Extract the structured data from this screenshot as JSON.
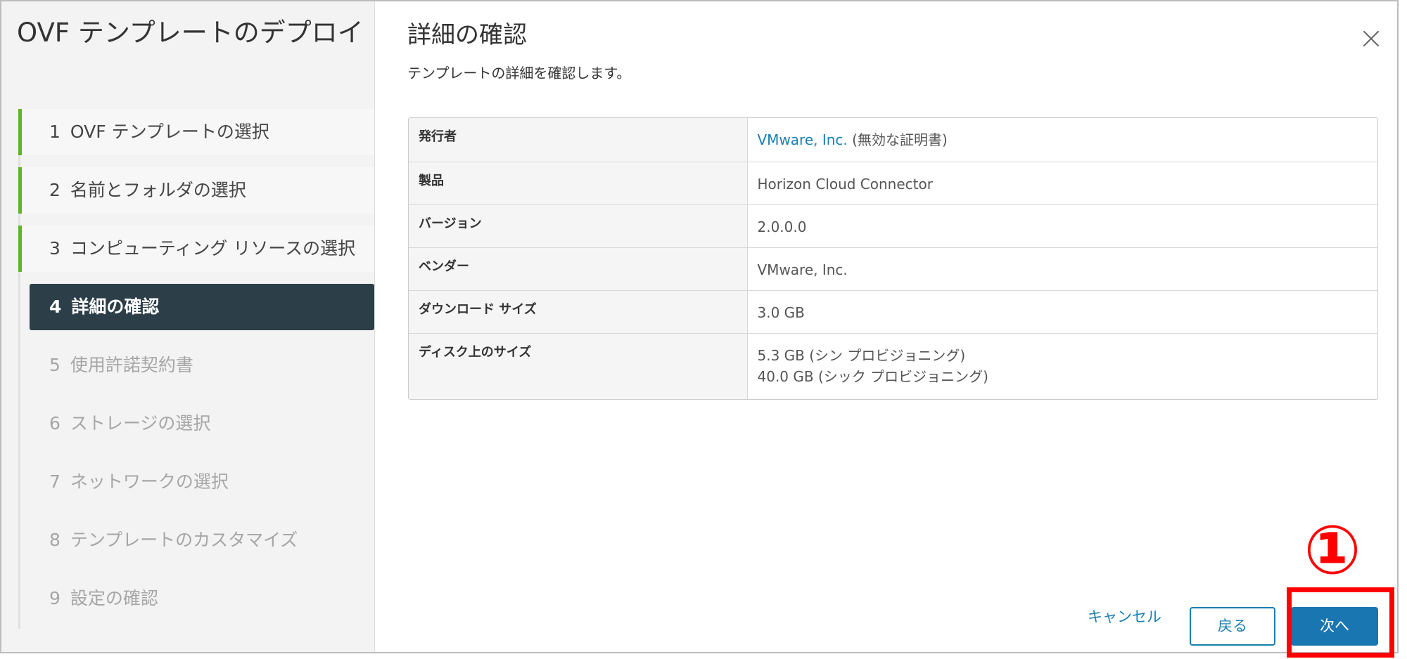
{
  "sidebar": {
    "title": "OVF テンプレートのデプロイ",
    "steps": [
      {
        "num": "1",
        "label": "OVF テンプレートの選択",
        "state": "done"
      },
      {
        "num": "2",
        "label": "名前とフォルダの選択",
        "state": "done"
      },
      {
        "num": "3",
        "label": "コンピューティング リソースの選択",
        "state": "done"
      },
      {
        "num": "4",
        "label": "詳細の確認",
        "state": "active"
      },
      {
        "num": "5",
        "label": "使用許諾契約書",
        "state": "pending"
      },
      {
        "num": "6",
        "label": "ストレージの選択",
        "state": "pending"
      },
      {
        "num": "7",
        "label": "ネットワークの選択",
        "state": "pending"
      },
      {
        "num": "8",
        "label": "テンプレートのカスタマイズ",
        "state": "pending"
      },
      {
        "num": "9",
        "label": "設定の確認",
        "state": "pending"
      }
    ]
  },
  "main": {
    "title": "詳細の確認",
    "subtitle": "テンプレートの詳細を確認します。",
    "close_icon": "close-icon",
    "details": [
      {
        "key": "発行者",
        "value_link": "VMware, Inc.",
        "value_suffix": " (無効な証明書)"
      },
      {
        "key": "製品",
        "value": "Horizon Cloud Connector"
      },
      {
        "key": "バージョン",
        "value": "2.0.0.0"
      },
      {
        "key": "ベンダー",
        "value": "VMware, Inc."
      },
      {
        "key": "ダウンロード サイズ",
        "value": "3.0 GB"
      },
      {
        "key": "ディスク上のサイズ",
        "value_line1": "5.3 GB (シン プロビジョニング)",
        "value_line2": "40.0 GB (シック プロビジョニング)"
      }
    ]
  },
  "footer": {
    "cancel_label": "キャンセル",
    "back_label": "戻る",
    "next_label": "次へ"
  },
  "annotation": {
    "marker": "①"
  },
  "colors": {
    "accent": "#1a76b0",
    "done_bar": "#5fb52a",
    "active_bg": "#2c3e48",
    "highlight": "#ff0000"
  }
}
